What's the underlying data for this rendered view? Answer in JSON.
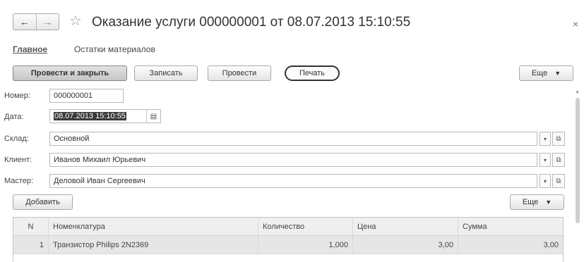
{
  "window": {
    "title": "Оказание услуги 000000001 от 08.07.2013 15:10:55",
    "back_glyph": "←",
    "forward_glyph": "→",
    "star_glyph": "☆",
    "close_glyph": "×"
  },
  "tabs": [
    {
      "label": "Главное",
      "active": true
    },
    {
      "label": "Остатки материалов",
      "active": false
    }
  ],
  "toolbar": {
    "post_close": "Провести и закрыть",
    "save": "Записать",
    "post": "Провести",
    "print": "Печать",
    "more": "Еще",
    "more_arrow": "▼"
  },
  "form": {
    "number_label": "Номер:",
    "number_value": "000000001",
    "date_label": "Дата:",
    "date_value": "08.07.2013 15:10:55",
    "calendar_glyph": "▤",
    "warehouse_label": "Склад:",
    "warehouse_value": "Основной",
    "client_label": "Клиент:",
    "client_value": "Иванов Михаил Юрьевич",
    "master_label": "Мастер:",
    "master_value": "Деловой Иван Сергеевич",
    "dropdown_glyph": "▾",
    "open_glyph": "⧉"
  },
  "table_toolbar": {
    "add": "Добавить",
    "more": "Еще",
    "more_arrow": "▼"
  },
  "table": {
    "columns": [
      "N",
      "Номенклатура",
      "Количество",
      "Цена",
      "Сумма"
    ],
    "rows": [
      {
        "n": "1",
        "item": "Транзистор Philips 2N2369",
        "qty": "1,000",
        "price": "3,00",
        "sum": "3,00"
      }
    ]
  },
  "scrollbar": {
    "up_glyph": "▲"
  },
  "colors": {
    "primary_button": "#c6c6c6",
    "selection": "#3a3a3a",
    "table_header": "#efefef",
    "table_row": "#e6e6e6"
  }
}
